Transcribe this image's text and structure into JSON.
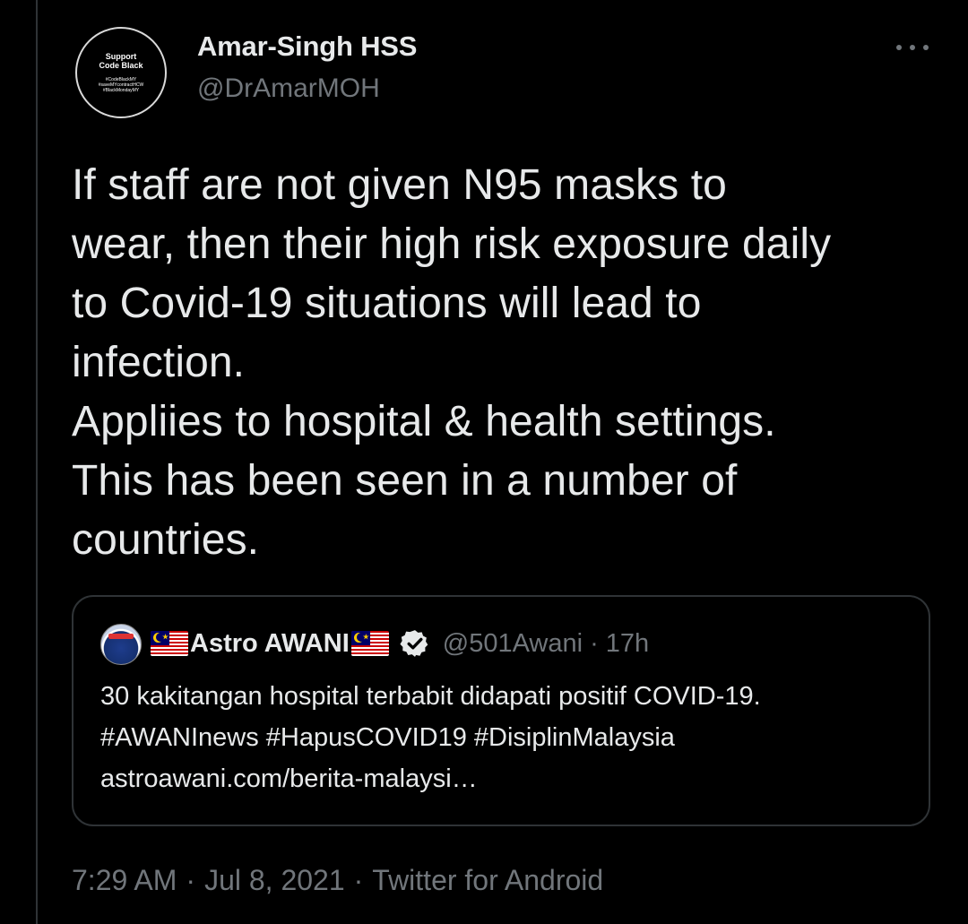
{
  "author": {
    "name": "Amar-Singh HSS",
    "handle": "@DrAmarMOH",
    "avatar_text": {
      "line1": "Support",
      "line2": "Code Black",
      "tags": [
        "#CodeBlackMY",
        "#saveMYcontractHCW",
        "#BlackMondayMY"
      ]
    }
  },
  "tweet": {
    "text": "If staff are not given N95 masks to\nwear, then their high risk exposure daily\nto Covid-19 situations will lead to\ninfection.\nAppliies to hospital & health settings.\nThis has been seen in a number of\ncountries."
  },
  "quoted": {
    "name": "Astro AWANI",
    "handle": "@501Awani",
    "separator": "·",
    "time": "17h",
    "lines": [
      "30 kakitangan hospital terbabit didapati positif COVID-19.",
      "#AWANInews #HapusCOVID19 #DisiplinMalaysia",
      "astroawani.com/berita-malaysi…"
    ]
  },
  "meta": {
    "time": "7:29 AM",
    "separator": "·",
    "date": "Jul 8, 2021",
    "source": "Twitter for Android"
  },
  "icons": {
    "more": "more-horizontal-icon",
    "verified": "verified-badge-icon",
    "flag": "malaysia-flag-icon"
  },
  "colors": {
    "background": "#000000",
    "text": "#e7e9ea",
    "secondary": "#71767b",
    "border": "#2f3336"
  }
}
